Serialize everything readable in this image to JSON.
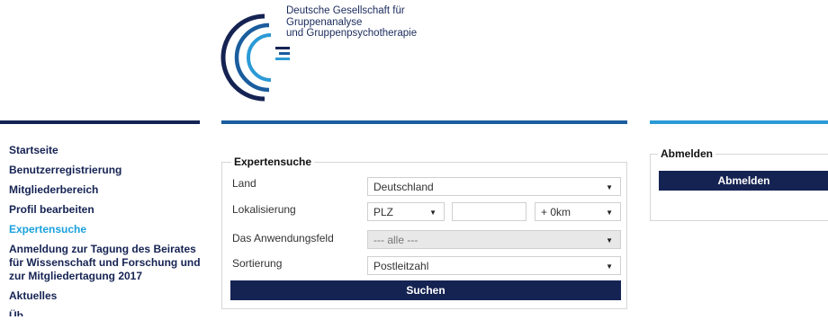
{
  "logo": {
    "lines": [
      "Deutsche Gesellschaft für",
      "Gruppenanalyse",
      "und Gruppenpsychotherapie"
    ]
  },
  "sidebar": {
    "items": [
      {
        "label": "Startseite"
      },
      {
        "label": "Benutzerregistrierung"
      },
      {
        "label": "Mitgliederbereich"
      },
      {
        "label": "Profil bearbeiten"
      },
      {
        "label": "Expertensuche",
        "active": true
      },
      {
        "label": "Anmeldung zur Tagung des Beirates für Wissenschaft und Forschung und zur Mitgliedertagung 2017"
      },
      {
        "label": "Aktuelles"
      },
      {
        "label": "Üb..."
      }
    ]
  },
  "search": {
    "title": "Expertensuche",
    "land_label": "Land",
    "land_value": "Deutschland",
    "lokalisierung_label": "Lokalisierung",
    "plz_value": "PLZ",
    "plz_input": "",
    "radius_value": "+ 0km",
    "feld_label": "Das Anwendungsfeld",
    "feld_value": "--- alle ---",
    "sortierung_label": "Sortierung",
    "sortierung_value": "Postleitzahl",
    "submit_label": "Suchen"
  },
  "logout": {
    "title": "Abmelden",
    "button_label": "Abmelden"
  },
  "colors": {
    "navy": "#152353",
    "active_link": "#1aa0dc",
    "rule_mid": "#1a5d9e",
    "rule_right": "#2b9ad6"
  }
}
